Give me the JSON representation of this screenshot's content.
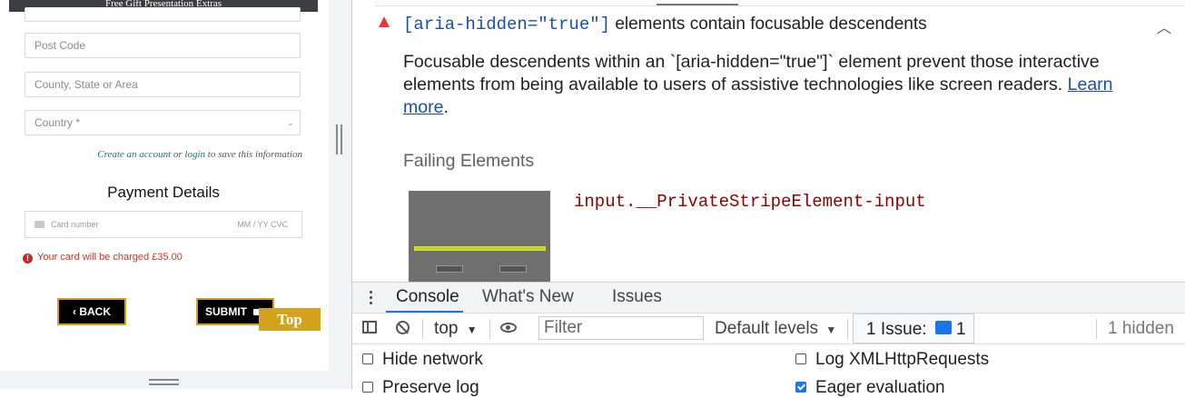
{
  "webpage": {
    "banner": "Free Gift Presentation Extras",
    "postcode_placeholder": "Post Code",
    "county_placeholder": "County, State or Area",
    "country_placeholder": "Country *",
    "account_create": "Create an account",
    "account_or": "or",
    "account_login": "login",
    "account_rest": "to save this information",
    "payment_title": "Payment Details",
    "card_number_placeholder": "Card number",
    "card_expiry_placeholder": "MM / YY  CVC",
    "charge_notice": "Your card will be charged £35.00",
    "back_label": "BACK",
    "submit_label": "SUBMIT",
    "top_label": "Top"
  },
  "issue": {
    "title_code": "[aria-hidden=\"true\"]",
    "title_rest": "elements contain focusable descendents",
    "description": "Focusable descendents within an `[aria-hidden=\"true\"]` element prevent those interactive elements from being available to users of assistive technologies like screen readers.",
    "learn_more": "Learn more",
    "period": ".",
    "failing_heading": "Failing Elements",
    "selector": "input.__PrivateStripeElement-input"
  },
  "drawer": {
    "tabs": [
      "Console",
      "What's New",
      "Issues"
    ]
  },
  "toolbar": {
    "context": "top",
    "filter_placeholder": "Filter",
    "levels": "Default levels",
    "issue_label": "1 Issue:",
    "issue_count": "1",
    "hidden": "1 hidden"
  },
  "settings": {
    "hide_network": "Hide network",
    "preserve_log": "Preserve log",
    "log_xhr": "Log XMLHttpRequests",
    "eager_eval": "Eager evaluation"
  },
  "colors": {
    "accent": "#1a73e8",
    "warning": "#e53935",
    "gold": "#d4a21c"
  }
}
